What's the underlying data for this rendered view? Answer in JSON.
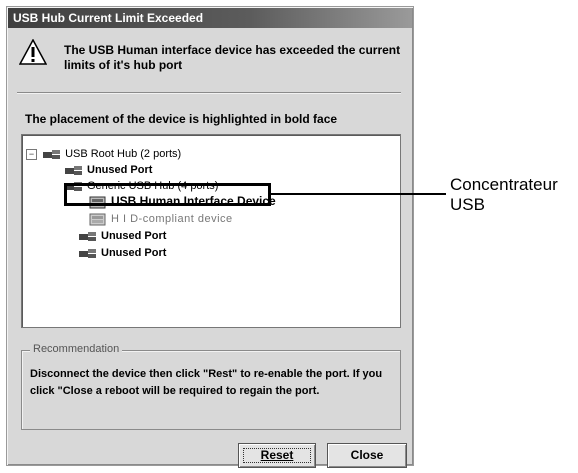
{
  "dialog": {
    "title": "USB Hub Current Limit Exceeded",
    "message": "The USB Human interface device has exceeded the current limits of it's hub port",
    "placement_text": "The placement of the device is highlighted in bold face",
    "tree": [
      {
        "label": "USB Root Hub (2 ports)",
        "bold": false,
        "expander": "⊟"
      },
      {
        "label": "Unused Port",
        "bold": true
      },
      {
        "label": "Generic USB Hub (4 ports)",
        "bold": false
      },
      {
        "label": "USB Human Interface Device",
        "bold": true,
        "highlighted": true
      },
      {
        "label": "H I D-compliant device",
        "bold": false
      },
      {
        "label": "Unused Port",
        "bold": true
      },
      {
        "label": "Unused Port",
        "bold": true
      }
    ],
    "recommendation": {
      "label": "Recommendation",
      "text": "Disconnect the device then click \"Rest\" to re-enable the port. If you click \"Close a reboot will be required to regain the port."
    },
    "buttons": {
      "reset": "Reset",
      "close": "Close"
    }
  },
  "callout": {
    "line1": "Concentrateur",
    "line2": "USB"
  },
  "icons": {
    "warning": "warning-triangle-icon",
    "usb": "usb-icon",
    "hid": "hid-device-icon"
  }
}
